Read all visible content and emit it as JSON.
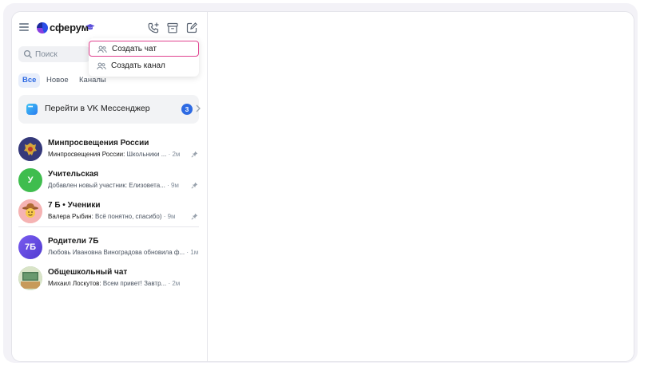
{
  "app": {
    "logo_text": "сферум"
  },
  "search": {
    "placeholder": "Поиск"
  },
  "menu": {
    "items": [
      {
        "label": "Создать чат",
        "icon": "users-icon",
        "highlighted": true
      },
      {
        "label": "Создать канал",
        "icon": "users-icon",
        "highlighted": false
      }
    ]
  },
  "tabs": [
    {
      "label": "Все",
      "active": true
    },
    {
      "label": "Новое",
      "active": false
    },
    {
      "label": "Каналы",
      "active": false
    }
  ],
  "promo": {
    "label": "Перейти в VK Мессенджер",
    "badge": "3"
  },
  "chats": [
    {
      "title": "Минпросвещения России",
      "sender": "Минпросвещения России:",
      "preview": " Школьники ...",
      "time": " · 2м",
      "pinned": true,
      "avatar": "emblem",
      "avatar_text": "",
      "avatar_color": "#35397a"
    },
    {
      "title": "Учительская",
      "sender": "",
      "preview": "Добавлен новый участник: Елизовета...",
      "time": " · 9м",
      "pinned": true,
      "avatar": "letter",
      "avatar_text": "У",
      "avatar_color": "#3fbd4e"
    },
    {
      "title": "7 Б • Ученики",
      "sender": "Валера Рыбин:",
      "preview": " Всё понятно, спасибо)",
      "time": " · 9м",
      "pinned": true,
      "avatar": "cowboy",
      "avatar_text": "",
      "avatar_color": "#f5b3b3"
    },
    {
      "title": "Родители 7Б",
      "sender": "Любовь Ивановна Виноградова обновила ф...",
      "preview": "",
      "time": " · 1м",
      "pinned": false,
      "avatar": "letter",
      "avatar_text": "7Б",
      "avatar_color": "#6a4fe0"
    },
    {
      "title": "Общешкольный чат",
      "sender": "Михаил Лоскутов:",
      "preview": " Всем привет! Завтр...",
      "time": " · 2м",
      "pinned": false,
      "avatar": "room",
      "avatar_text": "",
      "avatar_color": "#a7c7a0"
    }
  ],
  "colors": {
    "accent": "#2d6ae3",
    "highlight_border": "#e0418f"
  }
}
